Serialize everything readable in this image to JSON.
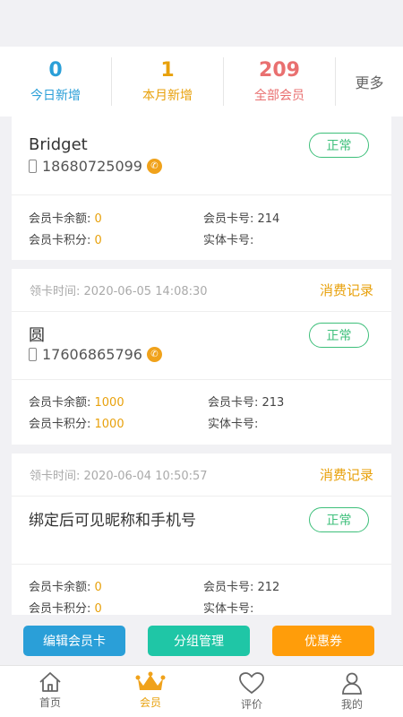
{
  "stats": [
    {
      "number": "0",
      "label": "今日新增",
      "color": "#2a9fd8"
    },
    {
      "number": "1",
      "label": "本月新增",
      "color": "#e8a10c"
    },
    {
      "number": "209",
      "label": "全部会员",
      "color": "#e97070"
    }
  ],
  "more_label": "更多",
  "members": [
    {
      "claim_time": "",
      "records_label": "",
      "name": "Bridget",
      "phone": "18680725099",
      "status": "正常",
      "balance_label": "会员卡余额: ",
      "balance": "0",
      "points_label": "会员卡积分: ",
      "points": "0",
      "card_no_label": "会员卡号: 214",
      "physical_card_label": "实体卡号:"
    },
    {
      "claim_time": "领卡时间: 2020-06-05 14:08:30",
      "records_label": "消费记录",
      "name": "圆",
      "phone": "17606865796",
      "status": "正常",
      "balance_label": "会员卡余额: ",
      "balance": "1000",
      "points_label": "会员卡积分: ",
      "points": "1000",
      "card_no_label": "会员卡号: 213",
      "physical_card_label": "实体卡号:"
    },
    {
      "claim_time": "领卡时间: 2020-06-04 10:50:57",
      "records_label": "消费记录",
      "name": "绑定后可见昵称和手机号",
      "phone": "",
      "status": "正常",
      "balance_label": "会员卡余额: ",
      "balance": "0",
      "points_label": "会员卡积分: ",
      "points": "0",
      "card_no_label": "会员卡号: 212",
      "physical_card_label": "实体卡号:"
    }
  ],
  "actions": [
    {
      "label": "编辑会员卡",
      "color": "#2a9fd8"
    },
    {
      "label": "分组管理",
      "color": "#1fc6a6"
    },
    {
      "label": "优惠券",
      "color": "#ff9d0a"
    }
  ],
  "tabs": [
    {
      "label": "首页",
      "icon": "home-icon",
      "active": false
    },
    {
      "label": "会员",
      "icon": "crown-icon",
      "active": true
    },
    {
      "label": "评价",
      "icon": "heart-icon",
      "active": false
    },
    {
      "label": "我的",
      "icon": "user-icon",
      "active": false
    }
  ]
}
